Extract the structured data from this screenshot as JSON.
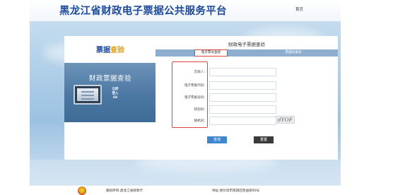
{
  "header": {
    "site_title": "黑龙江省财政电子票据公共服务平台",
    "home_link": "首页"
  },
  "sidebar": {
    "brand_part1": "票据",
    "brand_part2": "查验",
    "promo_title": "财政票据查验",
    "promo_side_text": [
      "立即",
      "登入",
      "60"
    ]
  },
  "main": {
    "heading": "财政电子票据查验",
    "tabs": [
      {
        "label": "电子票号查验",
        "active": true
      },
      {
        "label": "票面码查验",
        "active": false
      }
    ],
    "fields": [
      {
        "label": "交款人：",
        "value": ""
      },
      {
        "label": "电子票据代码：",
        "value": ""
      },
      {
        "label": "电子票据号码：",
        "value": ""
      },
      {
        "label": "校验码：",
        "value": ""
      },
      {
        "label": "随机码：",
        "value": ""
      }
    ],
    "captcha_text": "dYOF",
    "query_button": "查询",
    "reset_button": "重置"
  },
  "footer": {
    "copyright": "版权所有:黑龙江省财政厅",
    "address": "地址:哈尔滨市南岗区民益街90号"
  },
  "colors": {
    "title_blue": "#1d4a9a",
    "brand_orange": "#e3a11a",
    "tab_bar": "#8eaed0",
    "highlight_red": "#e0413a",
    "query_button": "#3f86cf",
    "reset_button": "#3a3a3a"
  }
}
